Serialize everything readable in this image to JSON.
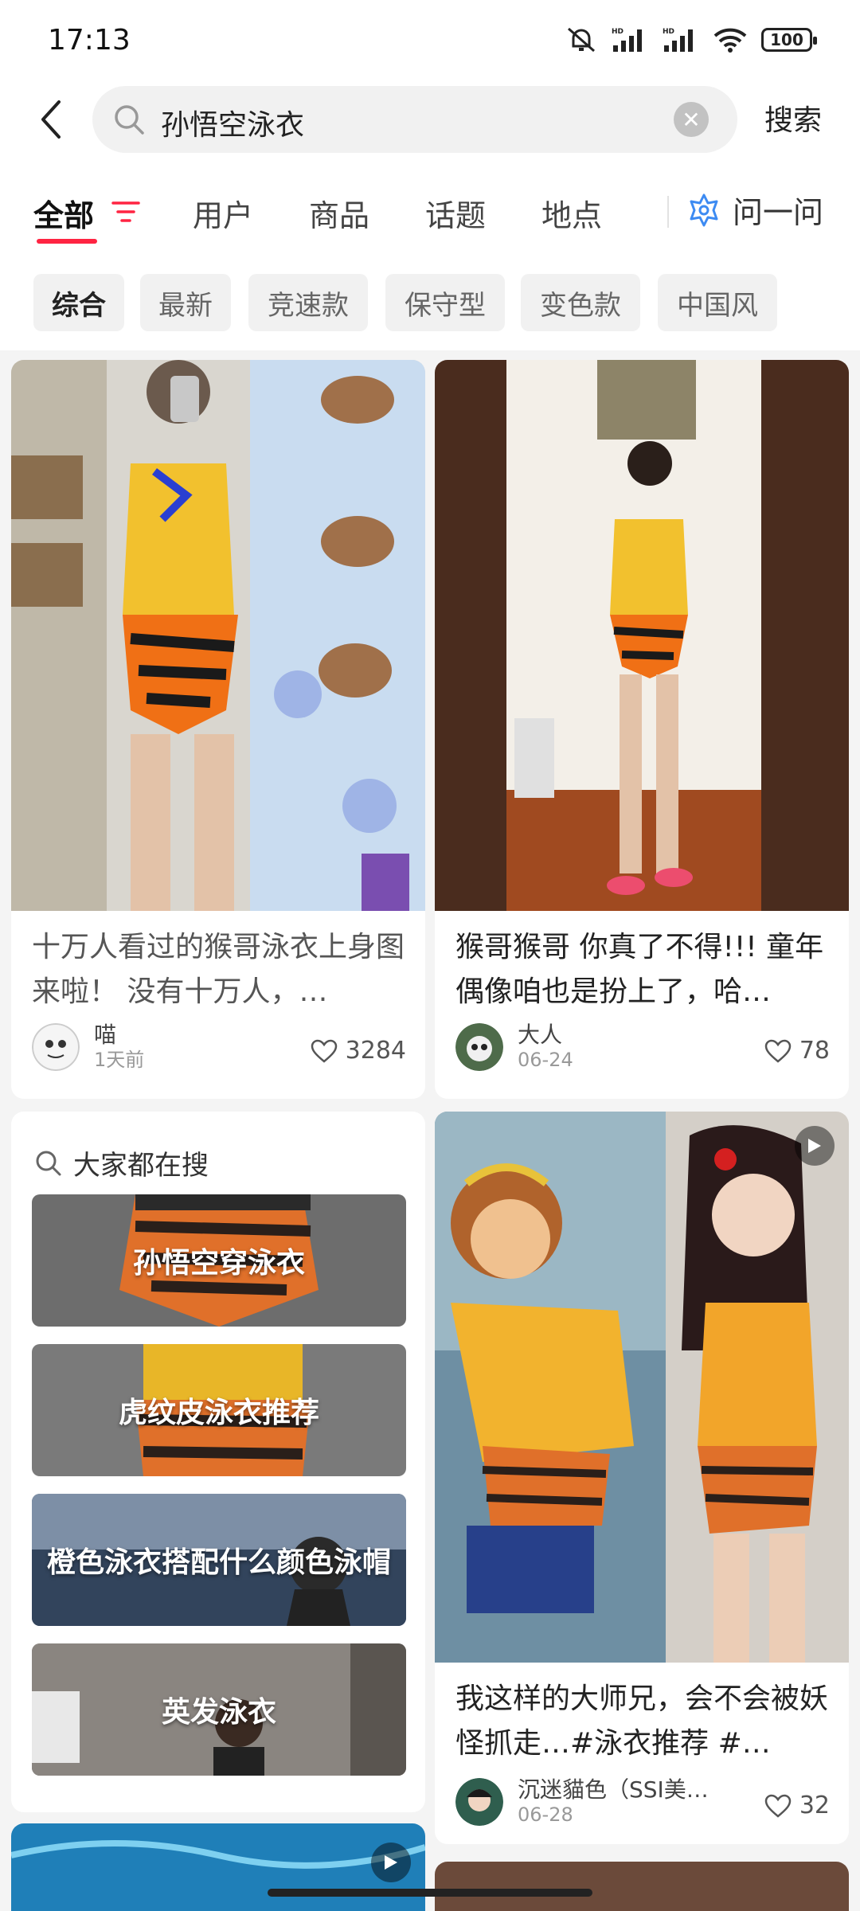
{
  "status": {
    "time": "17:13",
    "battery": "100"
  },
  "search": {
    "query": "孙悟空泳衣",
    "submit_label": "搜索"
  },
  "tabs": [
    {
      "label": "全部"
    },
    {
      "label": "用户"
    },
    {
      "label": "商品"
    },
    {
      "label": "话题"
    },
    {
      "label": "地点"
    }
  ],
  "ask_label": "问一问",
  "chips": [
    {
      "label": "综合"
    },
    {
      "label": "最新"
    },
    {
      "label": "竞速款"
    },
    {
      "label": "保守型"
    },
    {
      "label": "变色款"
    },
    {
      "label": "中国风"
    }
  ],
  "posts": [
    {
      "caption": "十万人看过的猴哥泳衣上身图来啦！ 没有十万人，…",
      "author": "喵",
      "date": "1天前",
      "likes": "3284"
    },
    {
      "caption": "猴哥猴哥 你真了不得!!! 童年偶像咱也是扮上了，哈…",
      "author": "大人",
      "date": "06-24",
      "likes": "78"
    },
    {
      "caption": "我这样的大师兄，会不会被妖怪抓走…#泳衣推荐 #…",
      "author": "沉迷貓色（SSI美…",
      "date": "06-28",
      "likes": "32"
    }
  ],
  "trending": {
    "title": "大家都在搜",
    "items": [
      {
        "label": "孙悟空穿泳衣"
      },
      {
        "label": "虎纹皮泳衣推荐"
      },
      {
        "label": "橙色泳衣搭配什么颜色泳帽"
      },
      {
        "label": "英发泳衣"
      }
    ]
  },
  "colors": {
    "accent": "#ff2442",
    "assistant": "#3d8bf2"
  }
}
